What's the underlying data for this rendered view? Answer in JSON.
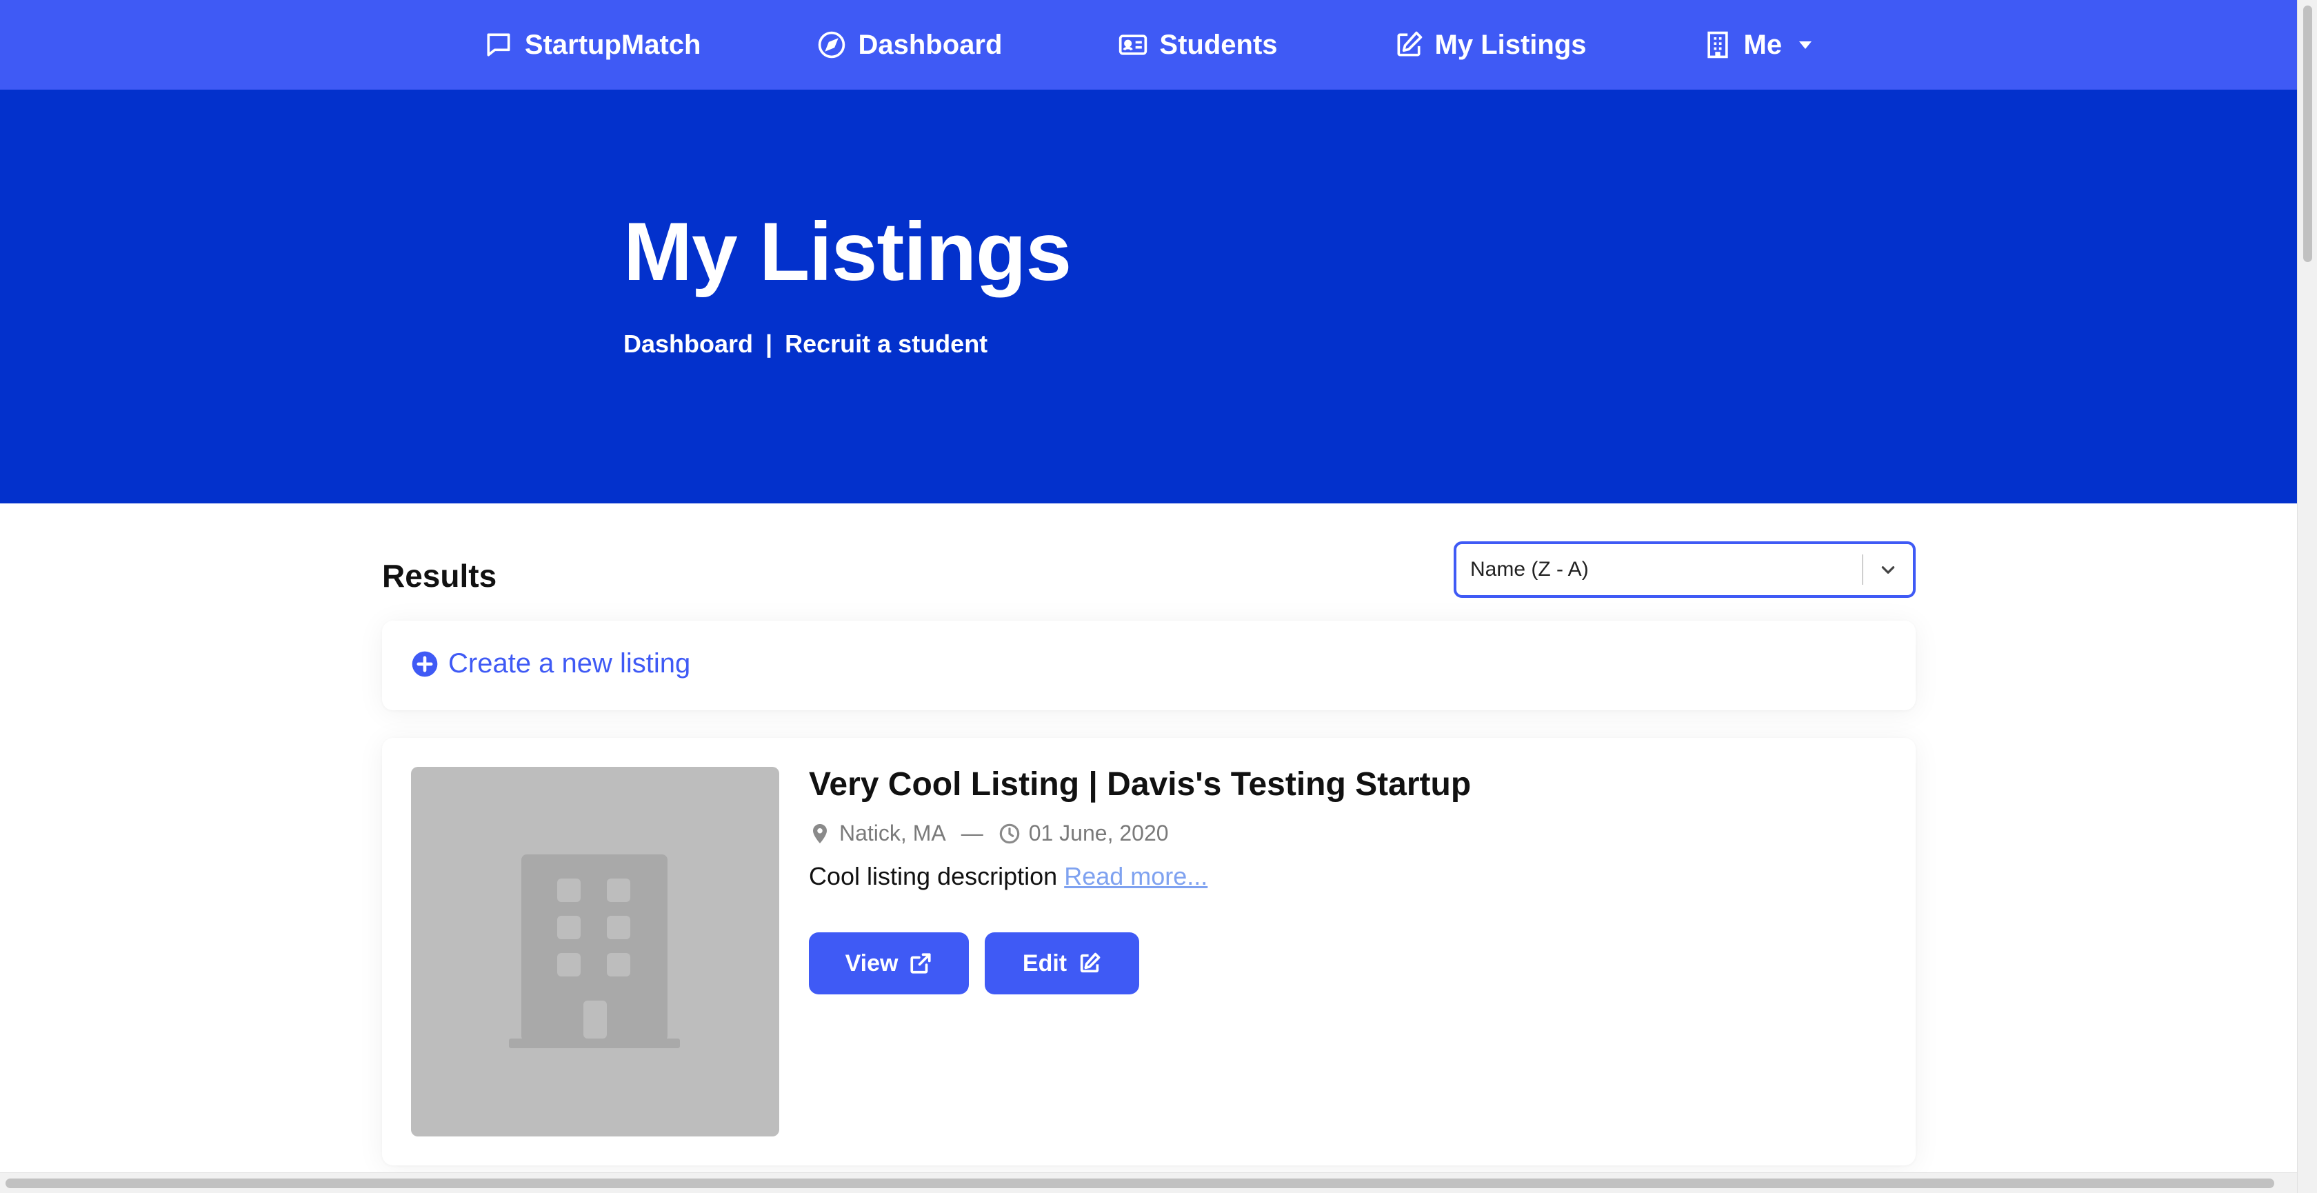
{
  "nav": {
    "brand_label": "StartupMatch",
    "dashboard_label": "Dashboard",
    "students_label": "Students",
    "listings_label": "My Listings",
    "me_label": "Me"
  },
  "hero": {
    "title": "My Listings",
    "breadcrumb": {
      "link1": "Dashboard",
      "separator": "|",
      "link2": "Recruit a student"
    }
  },
  "results": {
    "title": "Results",
    "sort": {
      "selected": "Name (Z - A)"
    },
    "create_label": "Create a new listing"
  },
  "listings": [
    {
      "title": "Very Cool Listing | Davis's Testing Startup",
      "location": "Natick, MA",
      "separator": "—",
      "date": "01 June, 2020",
      "description": "Cool listing description",
      "read_more": "Read more...",
      "view_label": "View",
      "edit_label": "Edit"
    }
  ],
  "colors": {
    "navbar": "#3f5af5",
    "hero": "#0331cc",
    "accent": "#3f5af5",
    "link_muted": "#7fa2f0"
  },
  "icons": {
    "brand": "chat-bubble-icon",
    "dashboard": "compass-icon",
    "students": "id-card-icon",
    "listings": "edit-square-icon",
    "me": "building-icon",
    "create": "plus-circle-icon",
    "location": "map-pin-icon",
    "date": "clock-icon",
    "view": "external-link-icon",
    "edit": "edit-square-icon"
  }
}
